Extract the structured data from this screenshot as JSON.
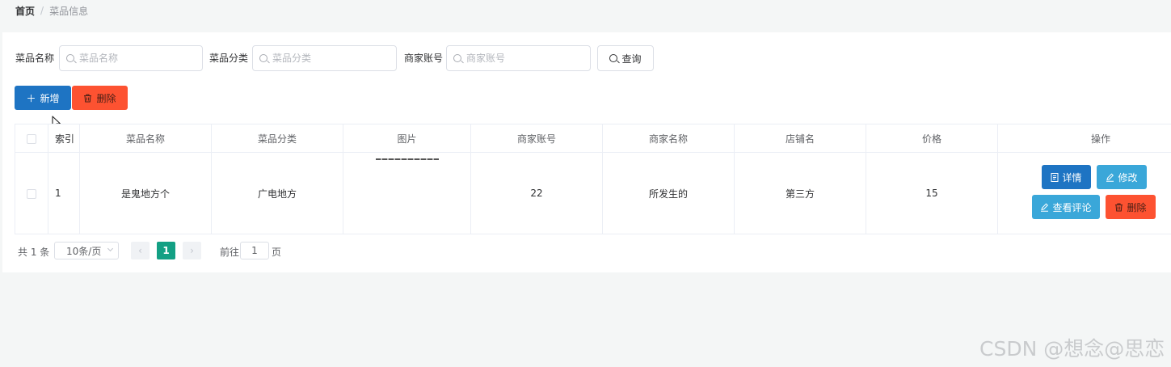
{
  "breadcrumb": {
    "home": "首页",
    "separator": "/",
    "current": "菜品信息"
  },
  "search": {
    "fields": [
      {
        "label": "菜品名称",
        "placeholder": "菜品名称",
        "value": ""
      },
      {
        "label": "菜品分类",
        "placeholder": "菜品分类",
        "value": ""
      },
      {
        "label": "商家账号",
        "placeholder": "商家账号",
        "value": ""
      }
    ],
    "query_label": "查询"
  },
  "toolbar": {
    "add_label": "新增",
    "delete_label": "删除"
  },
  "table": {
    "columns": [
      "索引",
      "菜品名称",
      "菜品分类",
      "图片",
      "商家账号",
      "商家名称",
      "店铺名",
      "价格",
      "操作"
    ],
    "rows": [
      {
        "index": "1",
        "name": "是鬼地方个",
        "category": "广电地方",
        "account": "22",
        "merchant": "所发生的",
        "shop": "第三方",
        "price": "15",
        "actions": {
          "detail": "详情",
          "edit": "修改",
          "comment": "查看评论",
          "delete": "删除"
        }
      }
    ]
  },
  "pagination": {
    "total": "共 1 条",
    "page_size": "10条/页",
    "current_page": "1",
    "goto_prefix": "前往",
    "goto_value": "1",
    "goto_suffix": "页"
  },
  "watermark": "CSDN @想念@思恋",
  "colors": {
    "primary": "#1e74c3",
    "info": "#3aa7d9",
    "danger": "#fd5231",
    "page_active": "#13a084"
  }
}
